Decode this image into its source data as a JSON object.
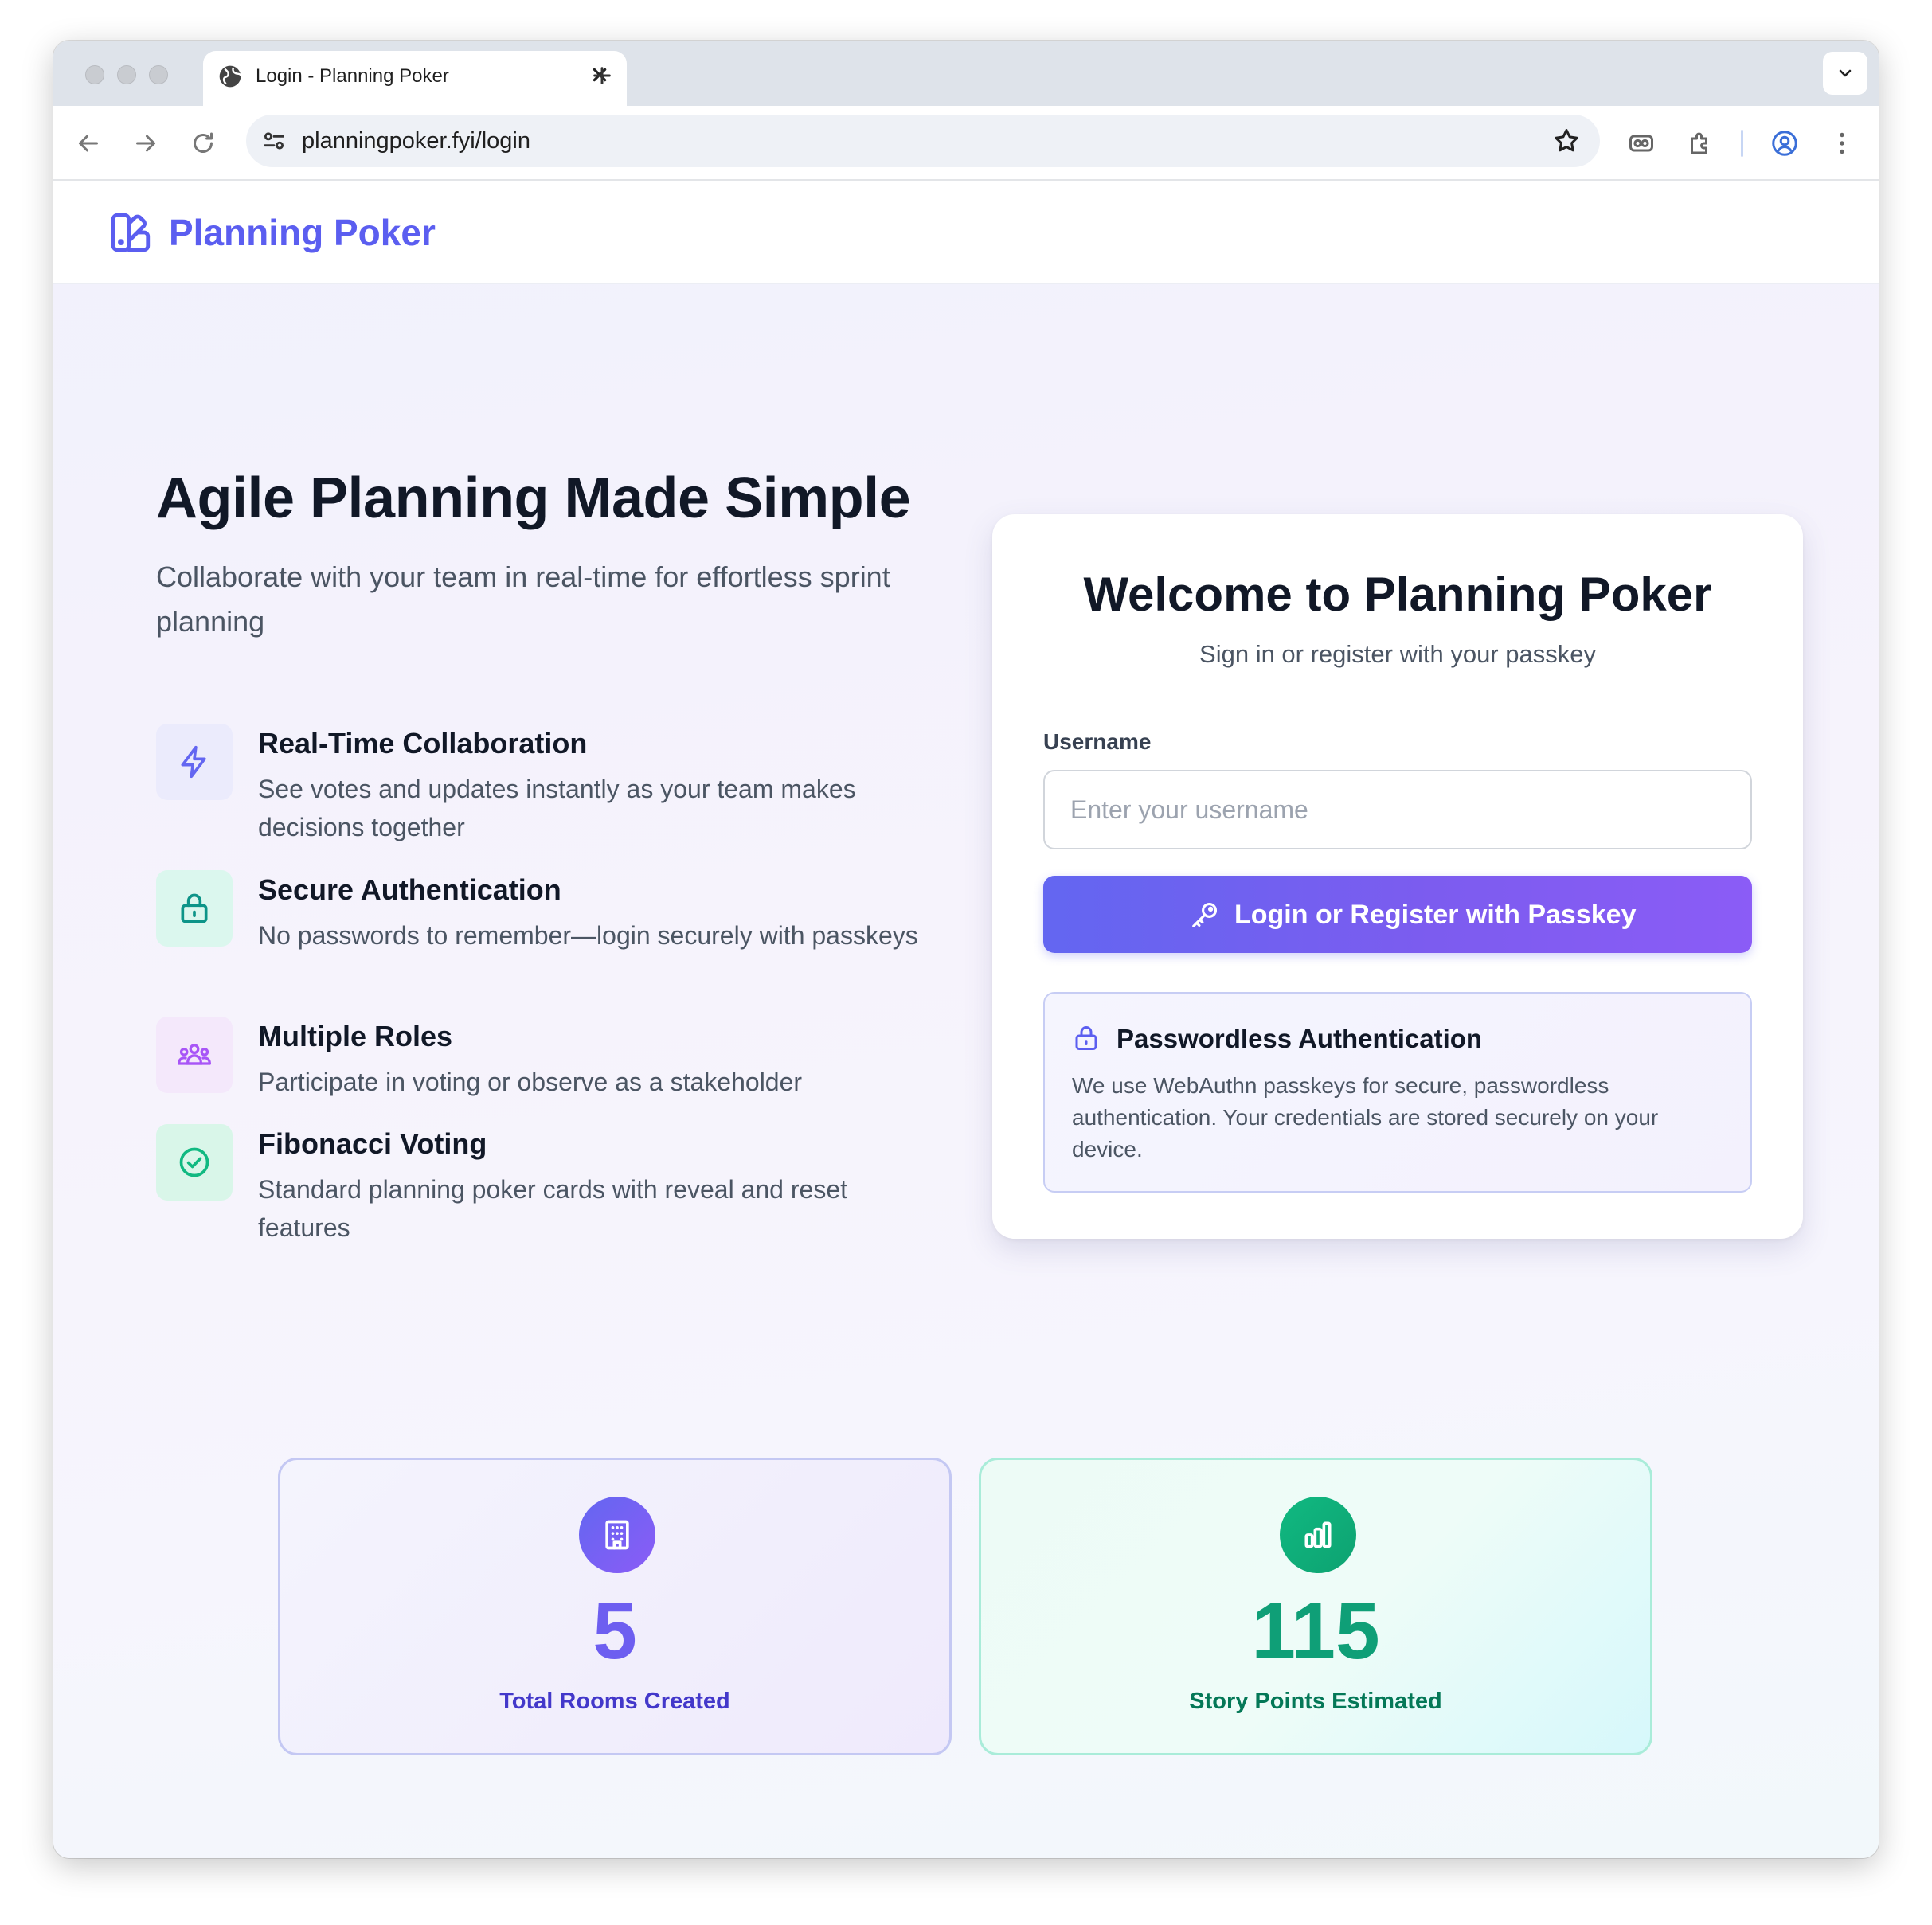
{
  "browser": {
    "tab_title": "Login - Planning Poker",
    "url": "planningpoker.fyi/login"
  },
  "app": {
    "name": "Planning Poker",
    "brand_color": "#5b5ef0"
  },
  "hero": {
    "title": "Agile Planning Made Simple",
    "subtitle": "Collaborate with your team in real-time for effortless sprint planning"
  },
  "features": [
    {
      "icon": "lightning-icon",
      "title": "Real-Time Collaboration",
      "description": "See votes and updates instantly as your team makes decisions together",
      "color": "#6366f1"
    },
    {
      "icon": "lock-icon",
      "title": "Secure Authentication",
      "description": "No passwords to remember—login securely with passkeys",
      "color": "#0d9488"
    },
    {
      "icon": "users-icon",
      "title": "Multiple Roles",
      "description": "Participate in voting or observe as a stakeholder",
      "color": "#a855f7"
    },
    {
      "icon": "check-circle-icon",
      "title": "Fibonacci Voting",
      "description": "Standard planning poker cards with reveal and reset features",
      "color": "#10b981"
    }
  ],
  "login": {
    "title": "Welcome to Planning Poker",
    "subtitle": "Sign in or register with your passkey",
    "username_label": "Username",
    "username_placeholder": "Enter your username",
    "username_value": "",
    "button_label": "Login or Register with Passkey",
    "info_title": "Passwordless Authentication",
    "info_text": "We use WebAuthn passkeys for secure, passwordless authentication. Your credentials are stored securely on your device."
  },
  "stats": [
    {
      "icon": "building-icon",
      "value": "5",
      "label": "Total Rooms Created",
      "color": "#6d5ef0"
    },
    {
      "icon": "bar-chart-icon",
      "value": "115",
      "label": "Story Points Estimated",
      "color": "#0f9f77"
    }
  ]
}
